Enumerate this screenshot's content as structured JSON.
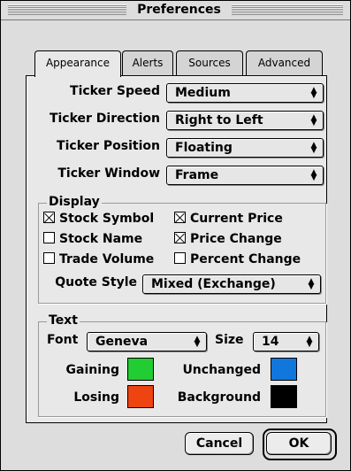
{
  "window": {
    "title": "Preferences"
  },
  "tabs": [
    {
      "label": "Appearance",
      "selected": true
    },
    {
      "label": "Alerts",
      "selected": false
    },
    {
      "label": "Sources",
      "selected": false
    },
    {
      "label": "Advanced",
      "selected": false
    }
  ],
  "ticker": {
    "speed": {
      "label": "Ticker Speed",
      "value": "Medium"
    },
    "direction": {
      "label": "Ticker Direction",
      "value": "Right to Left"
    },
    "position": {
      "label": "Ticker Position",
      "value": "Floating"
    },
    "window": {
      "label": "Ticker Window",
      "value": "Frame"
    }
  },
  "display": {
    "title": "Display",
    "options": [
      {
        "label": "Stock Symbol",
        "checked": true
      },
      {
        "label": "Current Price",
        "checked": true
      },
      {
        "label": "Stock Name",
        "checked": false
      },
      {
        "label": "Price Change",
        "checked": true
      },
      {
        "label": "Trade Volume",
        "checked": false
      },
      {
        "label": "Percent Change",
        "checked": false
      }
    ],
    "quote_style": {
      "label": "Quote Style",
      "value": "Mixed (Exchange)"
    }
  },
  "text": {
    "title": "Text",
    "font": {
      "label": "Font",
      "value": "Geneva"
    },
    "size": {
      "label": "Size",
      "value": "14"
    },
    "colors": {
      "gaining": {
        "label": "Gaining",
        "color": "#22cc33"
      },
      "unchanged": {
        "label": "Unchanged",
        "color": "#1177dd"
      },
      "losing": {
        "label": "Losing",
        "color": "#ee4411"
      },
      "background": {
        "label": "Background",
        "color": "#000000"
      }
    }
  },
  "buttons": {
    "cancel": "Cancel",
    "ok": "OK"
  }
}
